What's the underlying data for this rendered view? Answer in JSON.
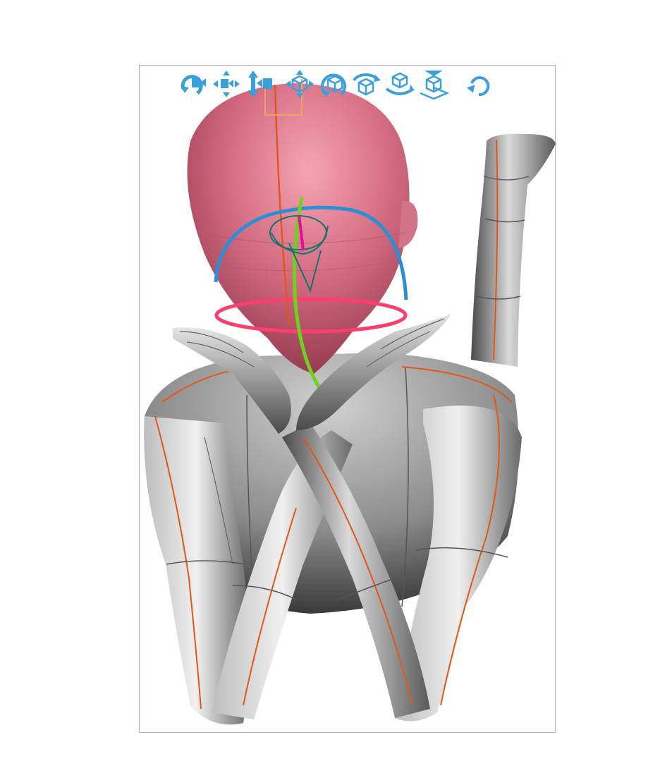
{
  "viewport": {
    "frame_color": "#a9a9ff",
    "background": "#ffffff"
  },
  "toolbar": {
    "accent_color": "#3aa0dc",
    "tools": [
      {
        "icon": "camera-rotate-icon"
      },
      {
        "icon": "camera-pan-icon"
      },
      {
        "icon": "camera-dolly-icon"
      },
      {
        "icon": "object-move-icon"
      },
      {
        "icon": "object-rotate-icon"
      },
      {
        "icon": "rotate-icon"
      },
      {
        "icon": "rotate-ground-icon"
      },
      {
        "icon": "place-on-ground-icon"
      },
      {
        "icon": "undo-icon"
      }
    ],
    "active_index": 3
  },
  "model": {
    "selected_part": "head",
    "head_color": "#d96a7e",
    "body_color": "#8a8a8a",
    "guide_line_color": "#e2581a",
    "manipulator": {
      "x_ring_color": "#2b8fd6",
      "y_ring_color": "#ff3d6e",
      "z_ring_color": "#6fd11a",
      "indicator_color": "#e0109a"
    }
  }
}
